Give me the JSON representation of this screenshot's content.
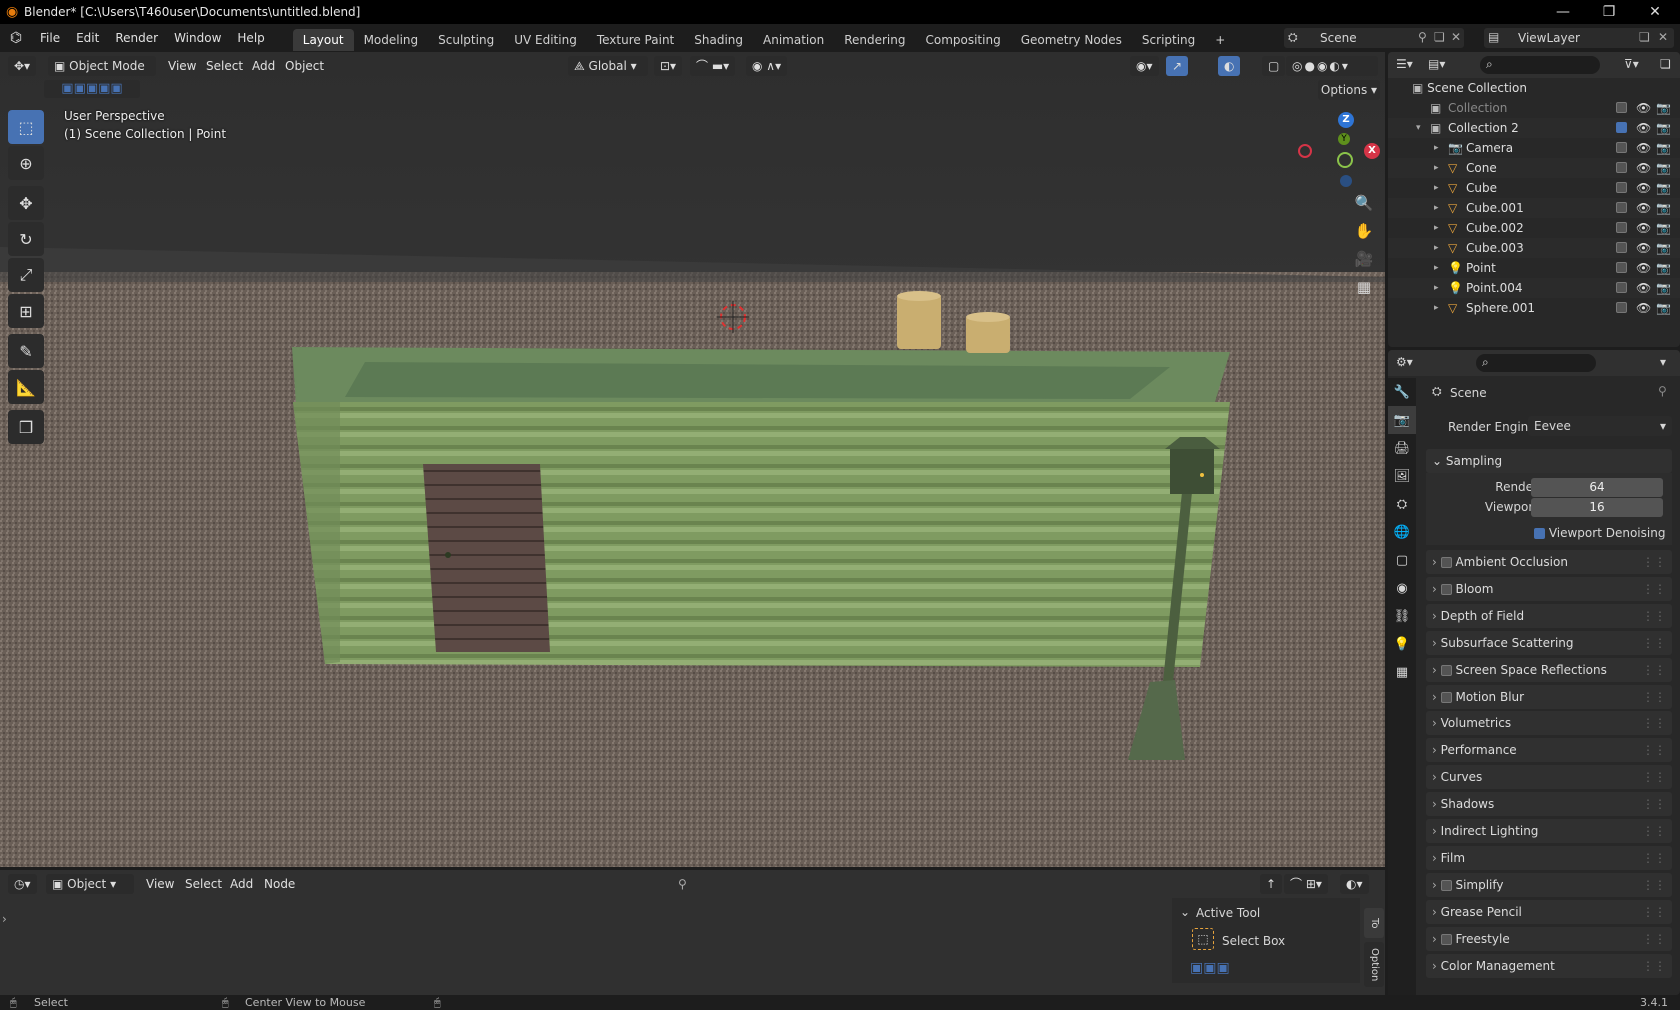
{
  "window": {
    "title": "Blender* [C:\\Users\\T460user\\Documents\\untitled.blend]",
    "minimize": "—",
    "restore": "❐",
    "close": "✕"
  },
  "menu": {
    "items": [
      "File",
      "Edit",
      "Render",
      "Window",
      "Help"
    ]
  },
  "workspaces": {
    "tabs": [
      "Layout",
      "Modeling",
      "Sculpting",
      "UV Editing",
      "Texture Paint",
      "Shading",
      "Animation",
      "Rendering",
      "Compositing",
      "Geometry Nodes",
      "Scripting"
    ],
    "add": "+",
    "active": "Layout"
  },
  "scene": {
    "name": "Scene",
    "view_layer": "ViewLayer"
  },
  "viewport": {
    "mode": "Object Mode",
    "menus": [
      "View",
      "Select",
      "Add",
      "Object"
    ],
    "transform_orientation": "Global",
    "options_label": "Options",
    "perspective_label": "User Perspective",
    "context_label": "(1) Scene Collection | Point",
    "gizmo": {
      "x": "X",
      "y": "Y",
      "z": "Z"
    }
  },
  "outliner": {
    "root": "Scene Collection",
    "items": [
      {
        "name": "Collection",
        "level": 1,
        "color": "#888888"
      },
      {
        "name": "Collection 2",
        "level": 1,
        "color": "#dedede"
      },
      {
        "name": "Camera",
        "level": 2,
        "color": "#dedede"
      },
      {
        "name": "Cone",
        "level": 2,
        "color": "#dedede"
      },
      {
        "name": "Cube",
        "level": 2,
        "color": "#dedede"
      },
      {
        "name": "Cube.001",
        "level": 2,
        "color": "#dedede"
      },
      {
        "name": "Cube.002",
        "level": 2,
        "color": "#dedede"
      },
      {
        "name": "Cube.003",
        "level": 2,
        "color": "#dedede"
      },
      {
        "name": "Point",
        "level": 2,
        "color": "#dedede"
      },
      {
        "name": "Point.004",
        "level": 2,
        "color": "#dedede"
      },
      {
        "name": "Sphere.001",
        "level": 2,
        "color": "#dedede"
      }
    ]
  },
  "properties": {
    "context": "Scene",
    "render_engine_label": "Render Engine",
    "render_engine": "Eevee",
    "sampling": {
      "title": "Sampling",
      "render_label": "Render",
      "render": "64",
      "viewport_label": "Viewport",
      "viewport": "16",
      "denoise_label": "Viewport Denoising"
    },
    "panels": [
      {
        "label": "Ambient Occlusion",
        "check": true
      },
      {
        "label": "Bloom",
        "check": true
      },
      {
        "label": "Depth of Field",
        "check": false
      },
      {
        "label": "Subsurface Scattering",
        "check": false
      },
      {
        "label": "Screen Space Reflections",
        "check": true
      },
      {
        "label": "Motion Blur",
        "check": true
      },
      {
        "label": "Volumetrics",
        "check": false
      },
      {
        "label": "Performance",
        "check": false
      },
      {
        "label": "Curves",
        "check": false
      },
      {
        "label": "Shadows",
        "check": false
      },
      {
        "label": "Indirect Lighting",
        "check": false
      },
      {
        "label": "Film",
        "check": false
      },
      {
        "label": "Simplify",
        "check": true
      },
      {
        "label": "Grease Pencil",
        "check": false
      },
      {
        "label": "Freestyle",
        "check": true
      },
      {
        "label": "Color Management",
        "check": false
      }
    ]
  },
  "editor": {
    "type": "Object",
    "menus": [
      "View",
      "Select",
      "Add",
      "Node"
    ],
    "active_tool_title": "Active Tool",
    "active_tool": "Select Box",
    "side_tab_tool": "To",
    "side_tab_option": "Option"
  },
  "status": {
    "left": "Select",
    "middle": "Center View to Mouse",
    "version": "3.4.1"
  }
}
